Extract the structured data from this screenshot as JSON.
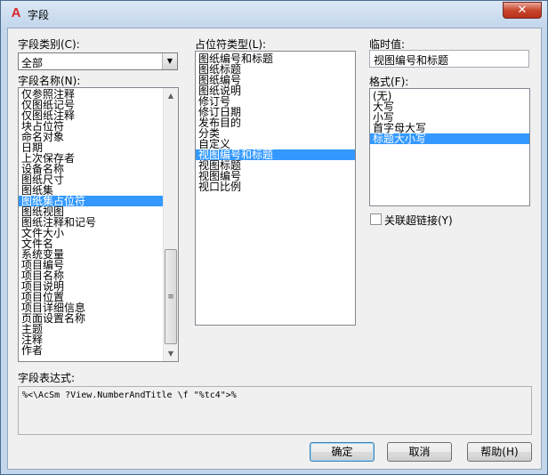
{
  "window": {
    "title": "字段",
    "close_label": "✕",
    "app_icon_label": "A"
  },
  "field_category": {
    "label": "字段类别(C):",
    "value": "全部"
  },
  "field_names": {
    "label": "字段名称(N):",
    "items": [
      "仅参照注释",
      "仅图纸记号",
      "仅图纸注释",
      "块占位符",
      "命名对象",
      "日期",
      "上次保存者",
      "设备名称",
      "图纸尺寸",
      "图纸集",
      "图纸集占位符",
      "图纸视图",
      "图纸注释和记号",
      "文件大小",
      "文件名",
      "系统变量",
      "项目编号",
      "项目名称",
      "项目说明",
      "项目位置",
      "项目详细信息",
      "页面设置名称",
      "主题",
      "注释",
      "作者"
    ],
    "selected": "图纸集占位符"
  },
  "placeholder_types": {
    "label": "占位符类型(L):",
    "items": [
      "图纸编号和标题",
      "图纸标题",
      "图纸编号",
      "图纸说明",
      "修订号",
      "修订日期",
      "发布目的",
      "分类",
      "自定义",
      "视图编号和标题",
      "视图标题",
      "视图编号",
      "视口比例"
    ],
    "selected": "视图编号和标题"
  },
  "temp_value": {
    "label": "临时值:",
    "value": "视图编号和标题"
  },
  "format": {
    "label": "格式(F):",
    "items": [
      "(无)",
      "大写",
      "小写",
      "首字母大写",
      "标题大小写"
    ],
    "selected": "标题大小写"
  },
  "hyperlink": {
    "label": "关联超链接(Y)",
    "checked": false
  },
  "expression": {
    "label": "字段表达式:",
    "value": "%<\\AcSm ?View.NumberAndTitle \\f \"%tc4\">%"
  },
  "buttons": {
    "ok": "确定",
    "cancel": "取消",
    "help": "帮助(H)"
  },
  "icons": {
    "dropdown": "chevron-down-icon",
    "scroll_up": "arrow-up-icon",
    "scroll_down": "arrow-down-icon"
  }
}
